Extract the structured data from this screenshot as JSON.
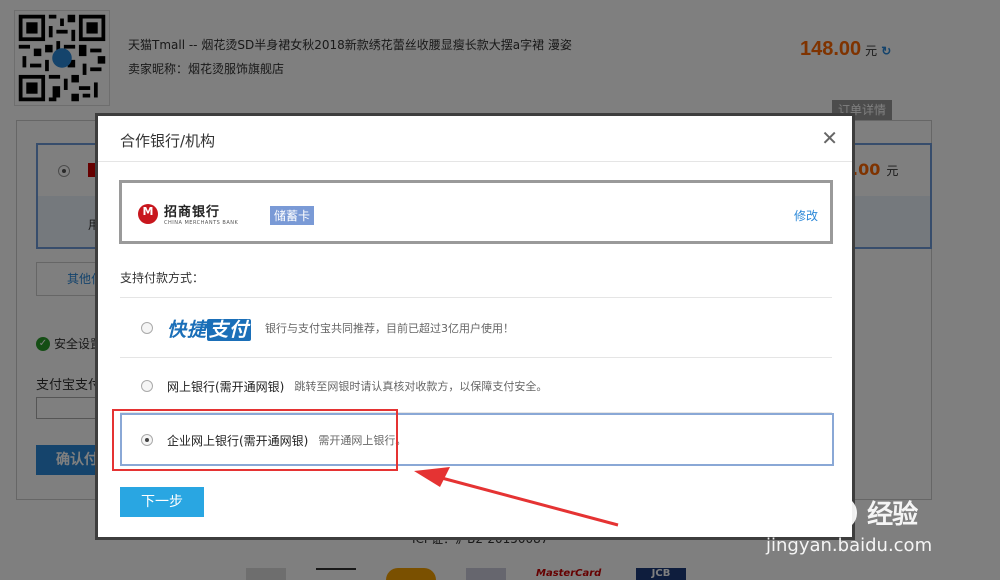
{
  "order": {
    "title": "天猫Tmall -- 烟花烫SD半身裙女秋2018新款绣花蕾丝收腰显瘦长款大摆a字裙 漫姿",
    "seller": "卖家昵称：烟花烫服饰旗舰店",
    "price": "148.00",
    "price_unit": "元",
    "detail_tab": "订单详情"
  },
  "background": {
    "amount": ".00",
    "amount_unit": "元",
    "use_text": "用",
    "other_label": "其他付",
    "security_label": "安全设置",
    "pwd_label": "支付宝支付",
    "confirm_label": "确认付",
    "icp": "ICP证：沪B2-20150087",
    "cards": [
      "",
      "",
      "",
      "",
      "MasterCard",
      "JCB"
    ]
  },
  "modal": {
    "title": "合作银行/机构",
    "close": "✕",
    "bank": {
      "name": "招商银行",
      "ename": "CHINA MERCHANTS BANK",
      "card_type": "储蓄卡",
      "modify": "修改"
    },
    "methods_label": "支持付款方式：",
    "methods": [
      {
        "logo_a": "快捷",
        "logo_b": "支付",
        "title": "",
        "desc": "银行与支付宝共同推荐，目前已超过3亿用户使用！",
        "checked": false
      },
      {
        "title": "网上银行(需开通网银)",
        "desc": "跳转至网银时请认真核对收款方，以保障支付安全。",
        "checked": false
      },
      {
        "title": "企业网上银行(需开通网银)",
        "desc": "需开通网上银行。",
        "checked": true
      }
    ],
    "next_label": "下一步"
  },
  "watermark": {
    "logo_left": "Bai",
    "logo_right": "",
    "cn": "经验",
    "url": "jingyan.baidu.com"
  },
  "colors": {
    "accent": "#29a6e2",
    "price": "#ff6600",
    "annotation": "#e53333"
  }
}
